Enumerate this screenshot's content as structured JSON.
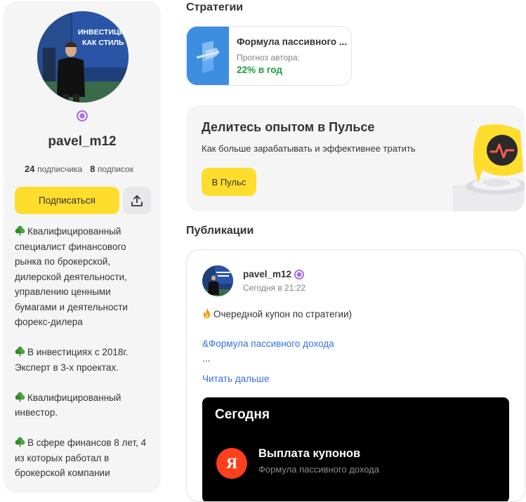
{
  "profile": {
    "username": "pavel_m12",
    "subscribers_count": "24",
    "subscribers_label": "подписчика",
    "subscriptions_count": "8",
    "subscriptions_label": "подписок",
    "subscribe_label": "Подписаться",
    "bio": [
      "Квалифицированный специалист финансового рынка по брокерской, дилерской деятельности, управлению ценными бумагами и деятельности форекс-дилера",
      "В инвестициях с 2018г. Эксперт в 3-х проектах.",
      "Квалифицированный инвестор.",
      "В сфере финансов 8 лет, 4 из которых  работал в брокерской компании"
    ],
    "avatar_banner_text": [
      "ИНВЕСТИЦИ",
      "КАК СТИЛЬ"
    ]
  },
  "strategies": {
    "title": "Стратегии",
    "items": [
      {
        "name": "Формула пассивного ...",
        "forecast_label": "Прогноз автора:",
        "forecast_value": "22% в год"
      }
    ]
  },
  "promo": {
    "title": "Делитесь опытом в Пульсе",
    "text": "Как больше зарабатывать и эффективнее тратить",
    "button_label": "В Пульс"
  },
  "publications": {
    "title": "Публикации",
    "post": {
      "author": "pavel_m12",
      "time": "Сегодня в 21:22",
      "text": "Очередной купон по стратегии)",
      "tag": "&Формула пассивного дохода",
      "ellipsis": "...",
      "read_more": "Читать дальше",
      "card": {
        "heading": "Сегодня",
        "logo_letter": "Я",
        "event_title": "Выплата купонов",
        "event_subtitle": "Формула пассивного дохода"
      }
    }
  },
  "colors": {
    "accent_yellow": "#ffdd2d",
    "link_blue": "#336fee",
    "positive_green": "#1aa03a",
    "verify_purple": "#a46ff0",
    "yandex_red": "#fc3f1d"
  }
}
